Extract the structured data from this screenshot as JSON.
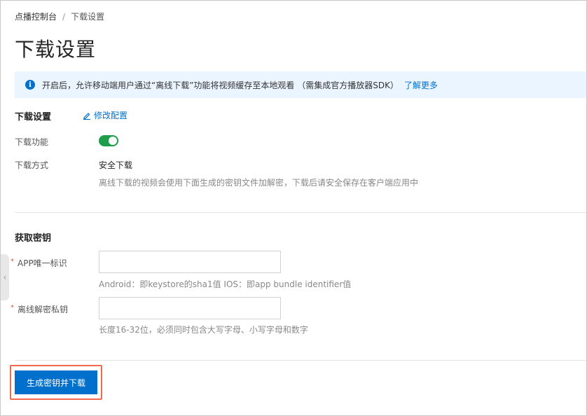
{
  "breadcrumb": {
    "root": "点播控制台",
    "separator": "/",
    "current": "下载设置"
  },
  "page": {
    "title": "下载设置"
  },
  "info": {
    "message": "开启后，允许移动端用户通过“离线下载”功能将视频缓存至本地观看 （需集成官方播放器SDK）",
    "link": "了解更多",
    "icon": "info-icon"
  },
  "download_settings": {
    "title": "下载设置",
    "edit_label": "修改配置",
    "feature_label": "下载功能",
    "feature_enabled": true,
    "mode_label": "下载方式",
    "mode_value": "安全下载",
    "mode_hint": "离线下载的视频会使用下面生成的密钥文件加解密，下载后请安全保存在客户端应用中"
  },
  "key_section": {
    "title": "获取密钥",
    "required_mark": "*",
    "app_id_label": "APP唯一标识",
    "app_id_value": "",
    "app_id_hint": "Android：即keystore的sha1值 IOS：即app bundle identifier值",
    "private_key_label": "离线解密私钥",
    "private_key_value": "",
    "private_key_hint": "长度16-32位，必须同时包含大写字母、小写字母和数字"
  },
  "actions": {
    "generate_label": "生成密钥并下载"
  },
  "colors": {
    "primary": "#0070cc",
    "toggle_on": "#1e9d4b",
    "highlight": "#ee6b4d",
    "info_bg": "#ebf5ff"
  }
}
